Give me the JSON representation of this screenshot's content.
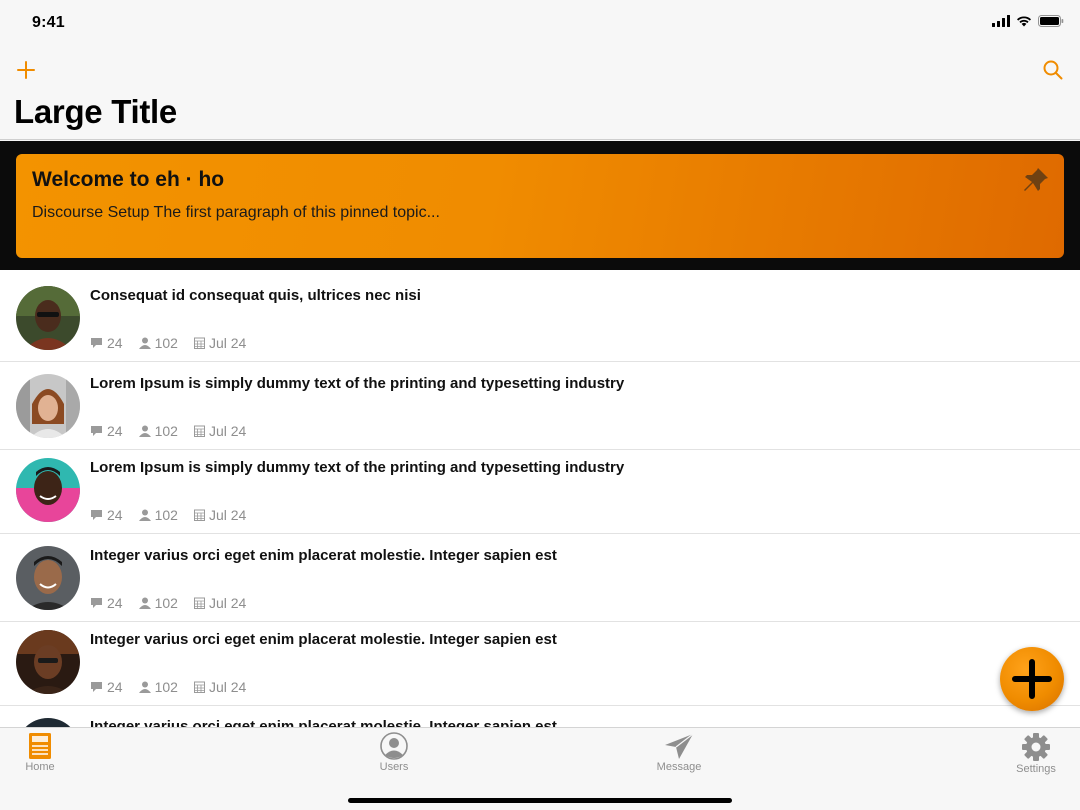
{
  "status_bar": {
    "time": "9:41"
  },
  "nav": {
    "title": "Large Title",
    "add_icon": "plus-icon",
    "search_icon": "search-icon",
    "accent": "#f08c00"
  },
  "pinned": {
    "title": "Welcome to eh · ho",
    "excerpt": "Discourse Setup The first paragraph of this pinned topic...",
    "icon": "pin-icon"
  },
  "topics": [
    {
      "title": "Consequat id consequat quis, ultrices nec nisi",
      "replies": "24",
      "views": "102",
      "date": "Jul 24"
    },
    {
      "title": "Lorem Ipsum is simply dummy text of the printing and typesetting industry",
      "replies": "24",
      "views": "102",
      "date": "Jul 24"
    },
    {
      "title": "Lorem Ipsum is simply dummy text of the printing and typesetting industry",
      "replies": "24",
      "views": "102",
      "date": "Jul 24"
    },
    {
      "title": "Integer varius orci eget enim placerat molestie. Integer sapien est",
      "replies": "24",
      "views": "102",
      "date": "Jul 24"
    },
    {
      "title": "Integer varius orci eget enim placerat molestie. Integer sapien est",
      "replies": "24",
      "views": "102",
      "date": "Jul 24"
    },
    {
      "title": "Integer varius orci eget enim placerat molestie. Integer sapien est",
      "replies": "",
      "views": "",
      "date": ""
    }
  ],
  "tabs": [
    {
      "label": "Home",
      "icon": "document-icon",
      "active": true
    },
    {
      "label": "Users",
      "icon": "user-icon",
      "active": false
    },
    {
      "label": "Message",
      "icon": "send-icon",
      "active": false
    },
    {
      "label": "Settings",
      "icon": "gear-icon",
      "active": false
    }
  ]
}
